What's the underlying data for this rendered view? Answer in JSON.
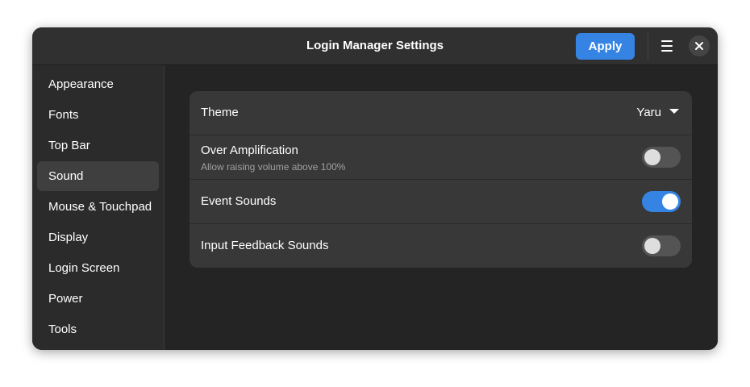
{
  "window": {
    "title": "Login Manager Settings",
    "apply_label": "Apply"
  },
  "sidebar": {
    "items": [
      {
        "label": "Appearance"
      },
      {
        "label": "Fonts"
      },
      {
        "label": "Top Bar"
      },
      {
        "label": "Sound",
        "selected": true
      },
      {
        "label": "Mouse & Touchpad"
      },
      {
        "label": "Display"
      },
      {
        "label": "Login Screen"
      },
      {
        "label": "Power"
      },
      {
        "label": "Tools"
      }
    ]
  },
  "sound": {
    "theme": {
      "label": "Theme",
      "value": "Yaru"
    },
    "over_amplification": {
      "label": "Over Amplification",
      "subtitle": "Allow raising volume above 100%",
      "enabled": false
    },
    "event_sounds": {
      "label": "Event Sounds",
      "enabled": true
    },
    "input_feedback_sounds": {
      "label": "Input Feedback Sounds",
      "enabled": false
    }
  },
  "colors": {
    "accent": "#3584e4",
    "window_bg": "#242424",
    "headerbar_bg": "#303030",
    "sidebar_bg": "#2b2b2b",
    "list_bg": "#383838"
  }
}
